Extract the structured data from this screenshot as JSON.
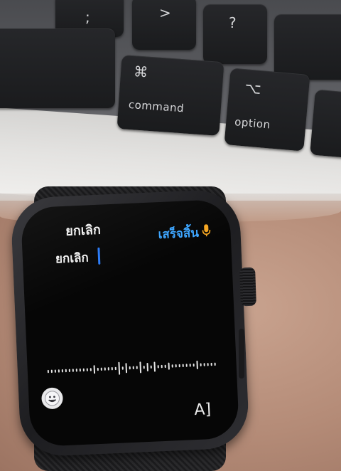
{
  "keyboard": {
    "keys": [
      {
        "glyph": ";",
        "label": ""
      },
      {
        "glyph": ">",
        "label": ""
      },
      {
        "glyph": "?",
        "label": ""
      },
      {
        "glyph": "⌘",
        "label": "command"
      },
      {
        "glyph": "⌥",
        "label": "option"
      }
    ]
  },
  "watch": {
    "cancel_label": "ยกเลิก",
    "done_label": "เสร็จสิ้น",
    "dictated_text": "ยกเลิก",
    "icons": {
      "mic": "microphone-icon",
      "emoji": "emoji-icon",
      "scribble": "scribble-icon"
    },
    "scribble_glyph": "A]",
    "colors": {
      "accent": "#3ea6ff",
      "mic": "#f5a623",
      "cursor": "#2d7cf6",
      "text": "#f0f0f0",
      "screen": "#060606"
    }
  }
}
